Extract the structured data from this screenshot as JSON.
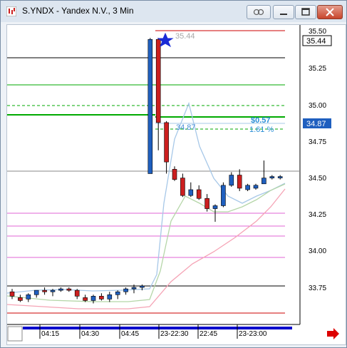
{
  "window": {
    "title": "S.YNDX - Yandex N.V., 3 Min"
  },
  "chart_data": {
    "type": "candlestick",
    "symbol": "S.YNDX",
    "y_ticks": [
      "35.50",
      "35.25",
      "35.00",
      "34.75",
      "34.50",
      "34.25",
      "34.00",
      "33.75"
    ],
    "x_ticks": [
      "04:15",
      "04:30",
      "04:45",
      "23-22:30",
      "22:45",
      "23-23:00"
    ],
    "price_tags": [
      {
        "label": "35.44",
        "color": "#000000",
        "bg": "#ffffff"
      },
      {
        "label": "34.87",
        "color": "#ffffff",
        "bg": "#1f5fbf"
      }
    ],
    "annotations": {
      "high_label": "35.44",
      "entry_label": "34.87",
      "change_value": "$0.57",
      "change_pct": "1.61 %"
    },
    "colors": {
      "up": "#1f5fbf",
      "down": "#cc1f1f",
      "ma_light_blue": "#a7c8e8",
      "ma_pink": "#f5a3b5",
      "ma_green": "#b5d6a8",
      "green_level": "#00aa00",
      "pink_level": "#e066d4",
      "red_level": "#cc0000"
    },
    "candles": [
      {
        "o": 33.71,
        "h": 33.73,
        "l": 33.66,
        "c": 33.68
      },
      {
        "o": 33.67,
        "h": 33.69,
        "l": 33.64,
        "c": 33.65
      },
      {
        "o": 33.66,
        "h": 33.7,
        "l": 33.64,
        "c": 33.69
      },
      {
        "o": 33.69,
        "h": 33.72,
        "l": 33.67,
        "c": 33.72
      },
      {
        "o": 33.72,
        "h": 33.74,
        "l": 33.69,
        "c": 33.71
      },
      {
        "o": 33.71,
        "h": 33.73,
        "l": 33.68,
        "c": 33.72
      },
      {
        "o": 33.72,
        "h": 33.74,
        "l": 33.71,
        "c": 33.73
      },
      {
        "o": 33.73,
        "h": 33.74,
        "l": 33.71,
        "c": 33.72
      },
      {
        "o": 33.72,
        "h": 33.73,
        "l": 33.66,
        "c": 33.68
      },
      {
        "o": 33.67,
        "h": 33.69,
        "l": 33.64,
        "c": 33.65
      },
      {
        "o": 33.65,
        "h": 33.69,
        "l": 33.63,
        "c": 33.68
      },
      {
        "o": 33.68,
        "h": 33.7,
        "l": 33.65,
        "c": 33.66
      },
      {
        "o": 33.66,
        "h": 33.71,
        "l": 33.64,
        "c": 33.69
      },
      {
        "o": 33.69,
        "h": 33.72,
        "l": 33.66,
        "c": 33.71
      },
      {
        "o": 33.71,
        "h": 33.74,
        "l": 33.69,
        "c": 33.73
      },
      {
        "o": 33.73,
        "h": 33.76,
        "l": 33.7,
        "c": 33.74
      },
      {
        "o": 33.74,
        "h": 33.76,
        "l": 33.72,
        "c": 33.75
      },
      {
        "o": 34.52,
        "h": 35.45,
        "l": 34.52,
        "c": 35.44
      },
      {
        "o": 35.44,
        "h": 35.45,
        "l": 34.68,
        "c": 34.87
      },
      {
        "o": 34.87,
        "h": 34.88,
        "l": 34.52,
        "c": 34.6
      },
      {
        "o": 34.55,
        "h": 34.57,
        "l": 34.47,
        "c": 34.48
      },
      {
        "o": 34.49,
        "h": 34.52,
        "l": 34.36,
        "c": 34.37
      },
      {
        "o": 34.37,
        "h": 34.46,
        "l": 34.36,
        "c": 34.41
      },
      {
        "o": 34.41,
        "h": 34.44,
        "l": 34.34,
        "c": 34.35
      },
      {
        "o": 34.35,
        "h": 34.38,
        "l": 34.26,
        "c": 34.28
      },
      {
        "o": 34.28,
        "h": 34.31,
        "l": 34.19,
        "c": 34.3
      },
      {
        "o": 34.3,
        "h": 34.46,
        "l": 34.29,
        "c": 34.44
      },
      {
        "o": 34.44,
        "h": 34.53,
        "l": 34.43,
        "c": 34.51
      },
      {
        "o": 34.51,
        "h": 34.55,
        "l": 34.4,
        "c": 34.42
      },
      {
        "o": 34.41,
        "h": 34.45,
        "l": 34.4,
        "c": 34.44
      },
      {
        "o": 34.42,
        "h": 34.45,
        "l": 34.41,
        "c": 34.44
      },
      {
        "o": 34.45,
        "h": 34.61,
        "l": 34.45,
        "c": 34.49
      },
      {
        "o": 34.49,
        "h": 34.51,
        "l": 34.48,
        "c": 34.5
      },
      {
        "o": 34.5,
        "h": 34.51,
        "l": 34.48,
        "c": 34.5
      }
    ]
  }
}
